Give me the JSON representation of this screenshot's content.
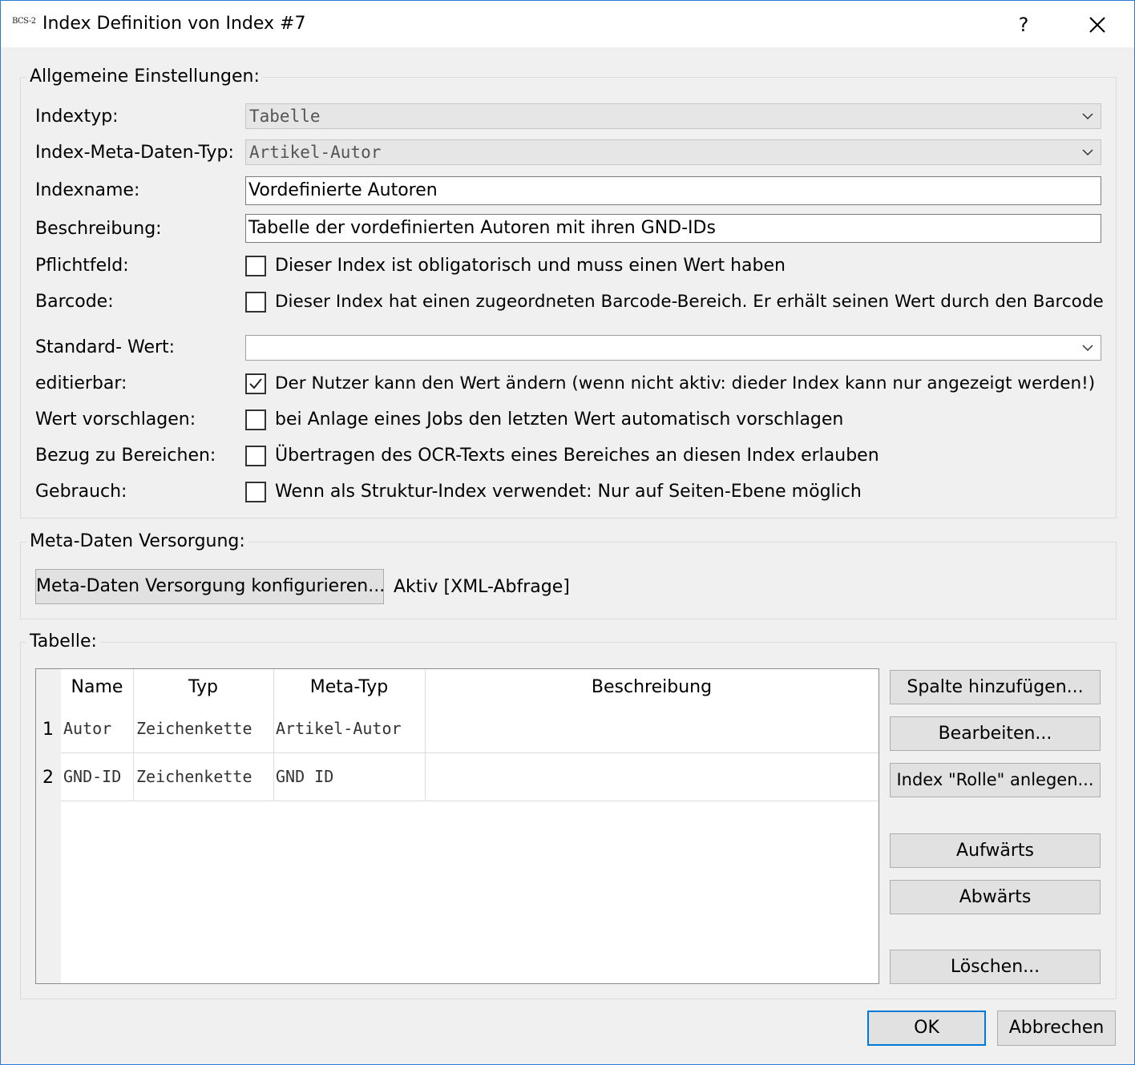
{
  "window": {
    "logo": "BCS-2",
    "title": "Index Definition von Index #7",
    "help": "?"
  },
  "general": {
    "title": "Allgemeine Einstellungen:",
    "indextyp_label": "Indextyp:",
    "indextyp_value": "Tabelle",
    "metatype_label": "Index-Meta-Daten-Typ:",
    "metatype_value": "Artikel-Autor",
    "name_label": "Indexname:",
    "name_value": "Vordefinierte Autoren",
    "desc_label": "Beschreibung:",
    "desc_value": "Tabelle der vordefinierten Autoren mit ihren GND-IDs",
    "required_label": "Pflichtfeld:",
    "required_text": "Dieser Index ist obligatorisch und muss einen Wert haben",
    "required_checked": false,
    "barcode_label": "Barcode:",
    "barcode_text": "Dieser Index hat einen zugeordneten Barcode-Bereich. Er erhält seinen Wert durch den Barcode",
    "barcode_checked": false,
    "default_label": "Standard- Wert:",
    "default_value": "",
    "editable_label": "editierbar:",
    "editable_text": "Der Nutzer kann den Wert ändern (wenn nicht aktiv: dieder Index kann nur angezeigt werden!)",
    "editable_checked": true,
    "suggest_label": "Wert vorschlagen:",
    "suggest_text": "bei Anlage eines Jobs den letzten Wert automatisch vorschlagen",
    "suggest_checked": false,
    "areas_label": "Bezug zu Bereichen:",
    "areas_text": "Übertragen des OCR-Texts eines Bereiches an diesen Index erlauben",
    "areas_checked": false,
    "usage_label": "Gebrauch:",
    "usage_text": "Wenn als Struktur-Index verwendet: Nur auf Seiten-Ebene möglich",
    "usage_checked": false
  },
  "metadata": {
    "title": "Meta-Daten Versorgung:",
    "configure_button": "Meta-Daten Versorgung konfigurieren...",
    "status": "Aktiv [XML-Abfrage]"
  },
  "table": {
    "title": "Tabelle:",
    "columns": [
      "Name",
      "Typ",
      "Meta-Typ",
      "Beschreibung"
    ],
    "rows": [
      {
        "num": "1",
        "name": "Autor",
        "typ": "Zeichenkette",
        "meta": "Artikel-Autor",
        "desc": ""
      },
      {
        "num": "2",
        "name": "GND-ID",
        "typ": "Zeichenkette",
        "meta": "GND ID",
        "desc": ""
      }
    ],
    "buttons": {
      "add": "Spalte hinzufügen...",
      "edit": "Bearbeiten...",
      "role": "Index \"Rolle\" anlegen...",
      "up": "Aufwärts",
      "down": "Abwärts",
      "delete": "Löschen..."
    }
  },
  "footer": {
    "ok": "OK",
    "cancel": "Abbrechen"
  }
}
